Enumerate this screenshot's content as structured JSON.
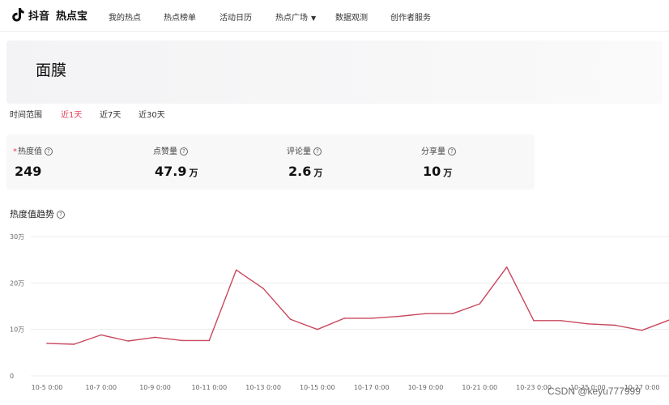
{
  "topbar": {
    "logo_text": "抖音",
    "logo_sub": "热点宝",
    "nav": [
      {
        "label": "我的热点"
      },
      {
        "label": "热点榜单"
      },
      {
        "label": "活动日历"
      },
      {
        "label": "热点广场"
      },
      {
        "label": "数据观测"
      },
      {
        "label": "创作者服务"
      }
    ],
    "icon": "tiktok-logo-icon"
  },
  "hero": {
    "title": "面膜"
  },
  "time_range": {
    "label": "时间范围",
    "options": [
      {
        "label": "近1天",
        "active": true
      },
      {
        "label": "近7天",
        "active": false
      },
      {
        "label": "近30天",
        "active": false
      }
    ]
  },
  "stats": [
    {
      "label": "热度值",
      "value": "249",
      "unit": ""
    },
    {
      "label": "点赞量",
      "value": "47.9",
      "unit": "万"
    },
    {
      "label": "评论量",
      "value": "2.6",
      "unit": "万"
    },
    {
      "label": "分享量",
      "value": "10",
      "unit": "万"
    }
  ],
  "trend": {
    "title": "热度值趋势"
  },
  "chart_data": {
    "type": "line",
    "title": "",
    "xlabel": "",
    "ylabel": "",
    "ylim": [
      0,
      300000
    ],
    "y_ticks": [
      {
        "value": 0,
        "label": "0"
      },
      {
        "value": 100000,
        "label": "10万"
      },
      {
        "value": 200000,
        "label": "20万"
      },
      {
        "value": 300000,
        "label": "30万"
      }
    ],
    "x": [
      "10-5 0:00",
      "10-6 0:00",
      "10-7 0:00",
      "10-8 0:00",
      "10-9 0:00",
      "10-10 0:00",
      "10-11 0:00",
      "10-12 0:00",
      "10-13 0:00",
      "10-14 0:00",
      "10-15 0:00",
      "10-16 0:00",
      "10-17 0:00",
      "10-18 0:00",
      "10-19 0:00",
      "10-20 0:00",
      "10-21 0:00",
      "10-22 0:00",
      "10-23 0:00",
      "10-24 0:00",
      "10-25 0:00",
      "10-26 0:00",
      "10-27 0:00",
      "10-28 0:00"
    ],
    "x_tick_labels": [
      "10-5 0:00",
      "10-7 0:00",
      "10-9 0:00",
      "10-11 0:00",
      "10-13 0:00",
      "10-15 0:00",
      "10-17 0:00",
      "10-19 0:00",
      "10-21 0:00",
      "10-23 0:00",
      "10-25 0:00",
      "10-27 0:00"
    ],
    "series": [
      {
        "values": [
          70000,
          68000,
          88000,
          75000,
          83000,
          76000,
          76000,
          228000,
          188000,
          122000,
          100000,
          124000,
          124000,
          128000,
          134000,
          134000,
          155000,
          234000,
          119000,
          119000,
          112000,
          109000,
          98000,
          120000
        ]
      }
    ],
    "grid": true,
    "color": "#c8485e"
  },
  "watermark": "CSDN @keyu777999"
}
